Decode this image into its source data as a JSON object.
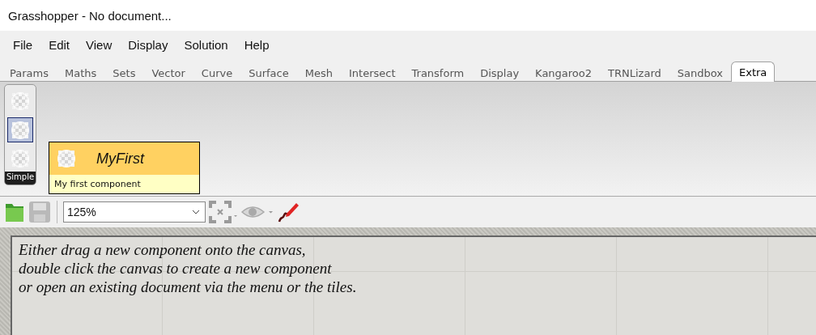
{
  "window": {
    "title": "Grasshopper - No document..."
  },
  "menu": [
    "File",
    "Edit",
    "View",
    "Display",
    "Solution",
    "Help"
  ],
  "tabs": [
    {
      "label": "Params",
      "selected": false
    },
    {
      "label": "Maths",
      "selected": false
    },
    {
      "label": "Sets",
      "selected": false
    },
    {
      "label": "Vector",
      "selected": false
    },
    {
      "label": "Curve",
      "selected": false
    },
    {
      "label": "Surface",
      "selected": false
    },
    {
      "label": "Mesh",
      "selected": false
    },
    {
      "label": "Intersect",
      "selected": false
    },
    {
      "label": "Transform",
      "selected": false
    },
    {
      "label": "Display",
      "selected": false
    },
    {
      "label": "Kangaroo2",
      "selected": false
    },
    {
      "label": "TRNLizard",
      "selected": false
    },
    {
      "label": "Sandbox",
      "selected": false
    },
    {
      "label": "Extra",
      "selected": true
    }
  ],
  "palette": {
    "label": "Simple",
    "items": [
      {
        "selected": false
      },
      {
        "selected": true
      },
      {
        "selected": false
      }
    ]
  },
  "tooltip": {
    "title": "MyFirst",
    "description": "My first component"
  },
  "toolbar": {
    "buttons": [
      {
        "kind": "open",
        "disabled": false
      },
      {
        "kind": "save",
        "disabled": true
      },
      {
        "kind": "zoom",
        "value": "125%"
      },
      {
        "kind": "extents",
        "disabled": true
      },
      {
        "kind": "preview",
        "disabled": true
      },
      {
        "kind": "sketch",
        "disabled": false
      }
    ]
  },
  "canvas": {
    "lines": [
      "Either drag a new component onto the canvas,",
      "double click the canvas to create a new component",
      "or open an existing document via the menu or the tiles."
    ]
  }
}
